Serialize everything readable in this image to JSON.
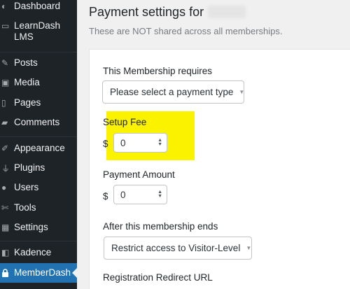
{
  "sidebar": {
    "items": [
      {
        "label": "Dashboard",
        "icon": "dashboard-icon",
        "glyph": "◐"
      },
      {
        "label": "LearnDash\nLMS",
        "icon": "learndash-icon",
        "glyph": "▭"
      },
      {
        "label": "Posts",
        "icon": "pin-icon",
        "glyph": "✎"
      },
      {
        "label": "Media",
        "icon": "media-icon",
        "glyph": "▣"
      },
      {
        "label": "Pages",
        "icon": "pages-icon",
        "glyph": "▯"
      },
      {
        "label": "Comments",
        "icon": "comments-icon",
        "glyph": "▰"
      },
      {
        "label": "Appearance",
        "icon": "brush-icon",
        "glyph": "✐"
      },
      {
        "label": "Plugins",
        "icon": "plugin-icon",
        "glyph": "⏚"
      },
      {
        "label": "Users",
        "icon": "users-icon",
        "glyph": "●"
      },
      {
        "label": "Tools",
        "icon": "wrench-icon",
        "glyph": "✄"
      },
      {
        "label": "Settings",
        "icon": "settings-icon",
        "glyph": "▦"
      },
      {
        "label": "Kadence",
        "icon": "kadence-icon",
        "glyph": "◧"
      },
      {
        "label": "MemberDash",
        "icon": "lock-icon",
        "glyph": "🔒"
      }
    ],
    "active_index": 12
  },
  "header": {
    "title": "Payment settings for",
    "subtitle": "These are NOT shared across all memberships."
  },
  "form": {
    "requires": {
      "label": "This Membership requires",
      "value": "Please select a payment type"
    },
    "setup_fee": {
      "label": "Setup Fee",
      "currency": "$",
      "value": "0"
    },
    "payment_amount": {
      "label": "Payment Amount",
      "currency": "$",
      "value": "0"
    },
    "after_ends": {
      "label": "After this membership ends",
      "value": "Restrict access to Visitor-Level"
    },
    "redirect": {
      "label": "Registration Redirect URL"
    }
  },
  "colors": {
    "sidebar_bg": "#1d2327",
    "active_bg": "#2271b1",
    "highlight": "#fbf200"
  }
}
